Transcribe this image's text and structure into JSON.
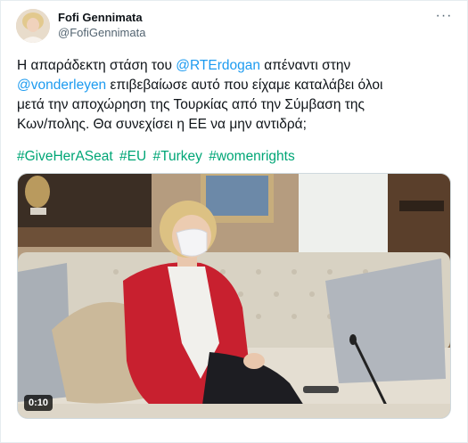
{
  "author": {
    "display_name": "Fofi Gennimata",
    "handle": "@FofiGennimata"
  },
  "menu_icon": "more-horizontal-icon",
  "tweet": {
    "p1": "Η απαράδεκτη στάση του ",
    "mention1": "@RTErdogan",
    "p2": " απέναντι στην",
    "mention2": "@vonderleyen",
    "p3": " επιβεβαίωσε αυτό που είχαμε καταλάβει όλοι",
    "line3": "μετά την αποχώρηση της Τουρκίας από την Σύμβαση της",
    "line4": "Κων/πολης. Θα συνεχίσει η ΕΕ να μην αντιδρά;"
  },
  "hashtags": [
    "#GiveHerASeat",
    "#EU",
    "#Turkey",
    "#womenrights"
  ],
  "video": {
    "duration": "0:10"
  },
  "colors": {
    "link": "#1d9bf0",
    "hashtag": "#00a676",
    "jacket": "#c8202f"
  }
}
